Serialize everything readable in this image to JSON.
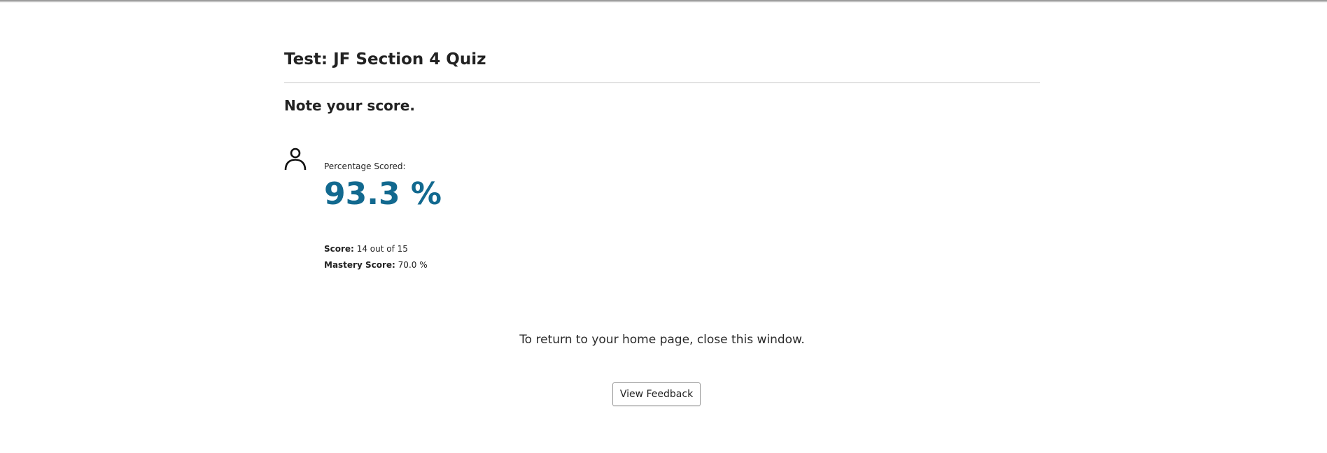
{
  "header": {
    "title": "Test: JF Section 4 Quiz"
  },
  "main": {
    "note": "Note your score.",
    "percentage_label": "Percentage Scored:",
    "percentage_value": "93.3 %",
    "score_label": "Score:",
    "score_value": "14 out of 15",
    "mastery_label": "Mastery Score:",
    "mastery_value": "70.0 %",
    "return_text": "To return to your home page, close this window.",
    "view_feedback_label": "View Feedback"
  },
  "icons": {
    "person": "person-icon"
  },
  "colors": {
    "accent": "#12698f",
    "text": "#222222",
    "divider": "#c8c8c8"
  }
}
